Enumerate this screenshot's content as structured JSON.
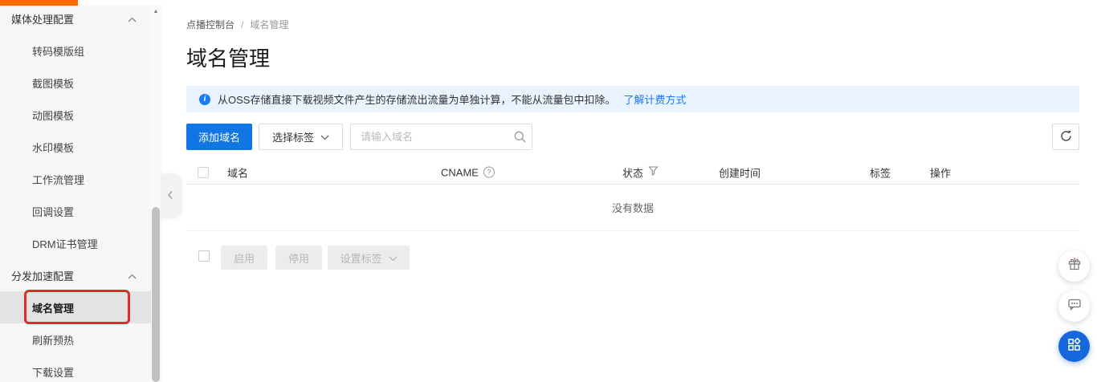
{
  "sidebar": {
    "groups": [
      {
        "label": "媒体处理配置",
        "items": [
          "转码模版组",
          "截图模板",
          "动图模板",
          "水印模板",
          "工作流管理",
          "回调设置",
          "DRM证书管理"
        ]
      },
      {
        "label": "分发加速配置",
        "items": [
          "域名管理",
          "刷新预热",
          "下载设置"
        ]
      }
    ],
    "active_item": "域名管理"
  },
  "breadcrumb": {
    "items": [
      "点播控制台",
      "域名管理"
    ],
    "separator": "/"
  },
  "page": {
    "title": "域名管理"
  },
  "banner": {
    "text": "从OSS存储直接下载视频文件产生的存储流出流量为单独计算，不能从流量包中扣除。",
    "link": "了解计费方式"
  },
  "toolbar": {
    "add_button": "添加域名",
    "tag_filter": "选择标签",
    "search_placeholder": "请输入域名"
  },
  "table": {
    "headers": [
      "域名",
      "CNAME",
      "状态",
      "创建时间",
      "标签",
      "操作"
    ],
    "empty_text": "没有数据"
  },
  "batch": {
    "enable": "启用",
    "disable": "停用",
    "set_tag": "设置标签"
  },
  "icons": {
    "info": "i",
    "help": "?",
    "scroll_up": "▲"
  },
  "colors": {
    "accent_orange": "#ff6a00",
    "primary_blue": "#1076e3",
    "link_blue": "#1a7af8",
    "banner_bg": "#e9f3fd",
    "annotation_red": "#e02b2b",
    "fab_blue": "#1667dc",
    "sidebar_bg": "#f6f6f6",
    "sidebar_active_bg": "#e3e3e3"
  }
}
